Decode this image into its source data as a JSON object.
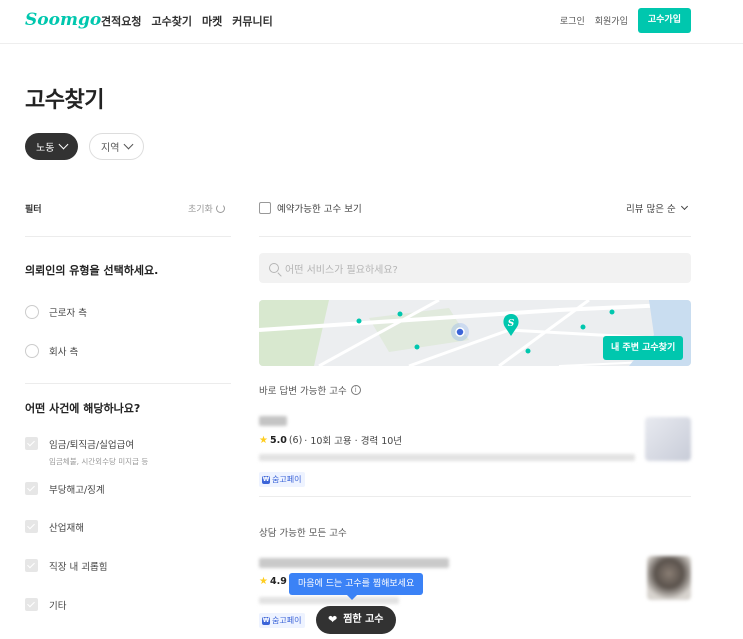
{
  "header": {
    "logo": "Soomgo",
    "nav": [
      "견적요청",
      "고수찾기",
      "마켓",
      "커뮤니티"
    ],
    "login": "로그인",
    "signup": "회원가입",
    "pro_signup": "고수가입"
  },
  "page_title": "고수찾기",
  "chips": {
    "category": "노동",
    "region": "지역"
  },
  "filter": {
    "title": "필터",
    "reset": "초기화",
    "client_type": {
      "title": "의뢰인의 유형을 선택하세요.",
      "options": [
        "근로자 측",
        "회사 측"
      ]
    },
    "case_type": {
      "title": "어떤 사건에 해당하나요?",
      "options": [
        {
          "label": "임금/퇴직금/실업급여",
          "sub": "임금체불, 시간외수당 미지급 등"
        },
        {
          "label": "부당해고/징계",
          "sub": ""
        },
        {
          "label": "산업재해",
          "sub": ""
        },
        {
          "label": "직장 내 괴롭힘",
          "sub": ""
        },
        {
          "label": "기타",
          "sub": ""
        }
      ]
    }
  },
  "main": {
    "available_only": "예약가능한 고수 보기",
    "sort": "리뷰 많은 순",
    "search_placeholder": "어떤 서비스가 필요하세요?",
    "map_button": "내 주변 고수찾기",
    "quick_reply_label": "바로 답변 가능한 고수",
    "pro1": {
      "rating": "5.0",
      "reviews": "(6)",
      "meta": "· 10회 고용 · 경력 10년",
      "pay": "숨고페이"
    },
    "all_label": "상담 가능한 모든 고수",
    "pro2": {
      "rating": "4.9",
      "reviews": "(",
      "pay": "숨고페이"
    },
    "tooltip": "마음에 드는 고수를 찜해보세요",
    "favorites_button": "찜한 고수"
  },
  "colors": {
    "brand": "#00c7ae",
    "dark": "#323232",
    "tooltip": "#3b82f6",
    "star": "#ffce21"
  }
}
